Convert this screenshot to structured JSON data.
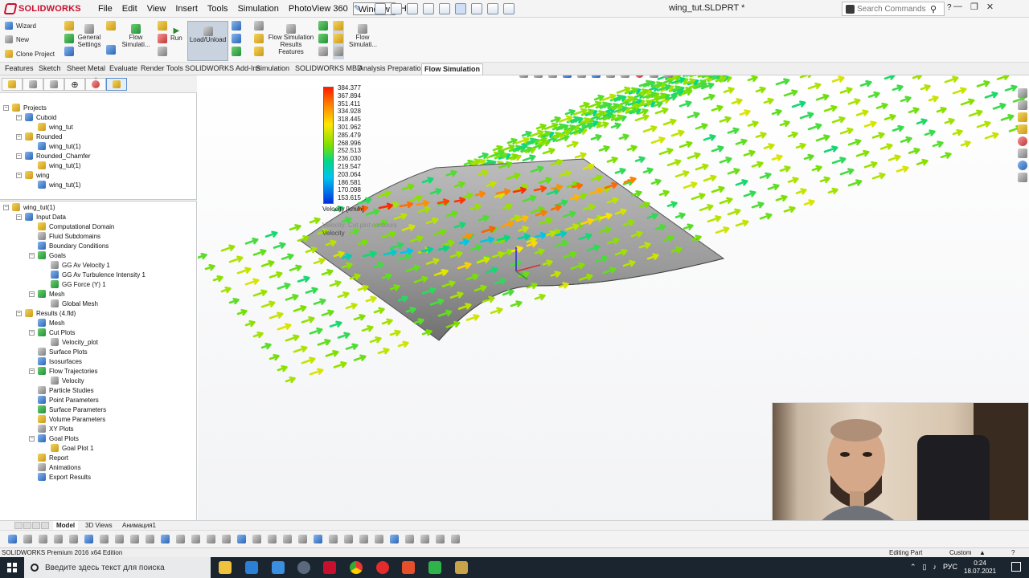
{
  "app": {
    "brand": "SOLIDWORKS",
    "document_title": "wing_tut.SLDPRT *",
    "search_placeholder": "Search Commands"
  },
  "menu": [
    "File",
    "Edit",
    "View",
    "Insert",
    "Tools",
    "Simulation",
    "PhotoView 360",
    "Window",
    "Help"
  ],
  "ribbon": {
    "wizard": "Wizard",
    "new": "New",
    "clone_project": "Clone Project",
    "general_settings": "General Settings",
    "flow_simulation": "Flow Simulati...",
    "run": "Run",
    "load_unload": "Load/Unload",
    "results_features": "Flow Simulation Results Features",
    "flow_simulation_2": "Flow Simulati..."
  },
  "tabs": [
    "Features",
    "Sketch",
    "Sheet Metal",
    "Evaluate",
    "Render Tools",
    "SOLIDWORKS Add-Ins",
    "Simulation",
    "SOLIDWORKS MBD",
    "Analysis Preparation",
    "Flow Simulation"
  ],
  "projects_tree": [
    {
      "label": "Projects",
      "level": 0,
      "icon": "folder-icon"
    },
    {
      "label": "Cuboid",
      "level": 1,
      "icon": "project-icon"
    },
    {
      "label": "wing_tut",
      "level": 2,
      "icon": "config-icon"
    },
    {
      "label": "Rounded",
      "level": 1,
      "icon": "project-icon"
    },
    {
      "label": "wing_tut(1)",
      "level": 2,
      "icon": "config-icon"
    },
    {
      "label": "Rounded_Chamfer",
      "level": 1,
      "icon": "project-icon"
    },
    {
      "label": "wing_tut(1)",
      "level": 2,
      "icon": "config-icon"
    },
    {
      "label": "wing",
      "level": 1,
      "icon": "project-icon"
    },
    {
      "label": "wing_tut(1)",
      "level": 2,
      "icon": "config-icon"
    }
  ],
  "analysis_tree": [
    {
      "label": "wing_tut(1)",
      "level": 0
    },
    {
      "label": "Input Data",
      "level": 1
    },
    {
      "label": "Computational Domain",
      "level": 2
    },
    {
      "label": "Fluid Subdomains",
      "level": 2
    },
    {
      "label": "Boundary Conditions",
      "level": 2
    },
    {
      "label": "Goals",
      "level": 2
    },
    {
      "label": "GG Av Velocity 1",
      "level": 3
    },
    {
      "label": "GG Av Turbulence Intensity 1",
      "level": 3
    },
    {
      "label": "GG Force (Y) 1",
      "level": 3
    },
    {
      "label": "Mesh",
      "level": 2
    },
    {
      "label": "Global Mesh",
      "level": 3
    },
    {
      "label": "Results (4.fld)",
      "level": 1
    },
    {
      "label": "Mesh",
      "level": 2
    },
    {
      "label": "Cut Plots",
      "level": 2
    },
    {
      "label": "Velocity_plot",
      "level": 3
    },
    {
      "label": "Surface Plots",
      "level": 2
    },
    {
      "label": "Isosurfaces",
      "level": 2
    },
    {
      "label": "Flow Trajectories",
      "level": 2
    },
    {
      "label": "Velocity",
      "level": 3
    },
    {
      "label": "Particle Studies",
      "level": 2
    },
    {
      "label": "Point Parameters",
      "level": 2
    },
    {
      "label": "Surface Parameters",
      "level": 2
    },
    {
      "label": "Volume Parameters",
      "level": 2
    },
    {
      "label": "XY Plots",
      "level": 2
    },
    {
      "label": "Goal Plots",
      "level": 2
    },
    {
      "label": "Goal Plot 1",
      "level": 3
    },
    {
      "label": "Report",
      "level": 2
    },
    {
      "label": "Animations",
      "level": 2
    },
    {
      "label": "Export Results",
      "level": 2
    }
  ],
  "legend": {
    "values": [
      "384.377",
      "367.894",
      "351.411",
      "334.928",
      "318.445",
      "301.962",
      "285.479",
      "268.996",
      "252.513",
      "236.030",
      "219.547",
      "203.064",
      "186.581",
      "170.098",
      "153.615"
    ],
    "title": "Velocity [km/h]",
    "overlay_1": "Velocity: Cut plot contours",
    "overlay_2": "Velocity"
  },
  "bottom_tabs": [
    "Model",
    "3D Views",
    "Анимация1"
  ],
  "status": {
    "edition": "SOLIDWORKS Premium 2016 x64 Edition",
    "editing": "Editing Part",
    "units": "Custom"
  },
  "taskbar": {
    "search_text": "Введите здесь текст для поиска",
    "lang": "РУС",
    "time": "0:24",
    "date": "18.07.2021"
  },
  "colors": {
    "brand": "#c8102e",
    "accent": "#3a78c4",
    "taskbar": "#1b2530"
  }
}
